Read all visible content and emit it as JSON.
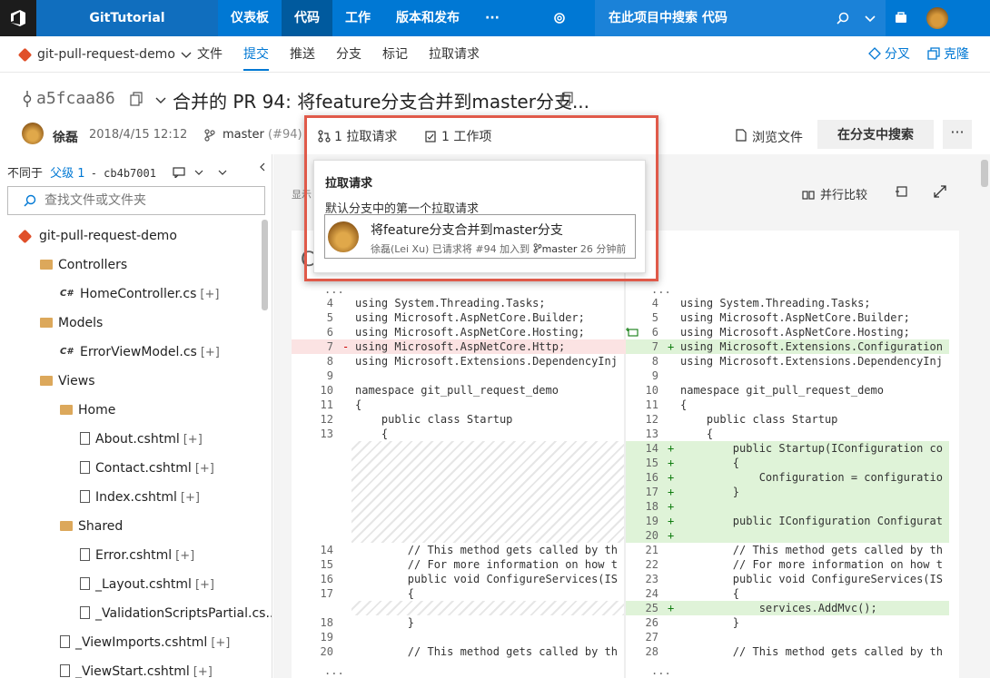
{
  "topbar": {
    "project": "GitTutorial",
    "nav": [
      "仪表板",
      "代码",
      "工作",
      "版本和发布",
      "···"
    ],
    "active": "代码",
    "search_placeholder": "在此项目中搜索 代码"
  },
  "subnav": {
    "repo": "git-pull-request-demo",
    "tabs": [
      "文件",
      "提交",
      "推送",
      "分支",
      "标记",
      "拉取请求"
    ],
    "active": "提交",
    "fork": "分叉",
    "clone": "克隆"
  },
  "commit": {
    "hash": "a5fcaa86",
    "title": "合并的 PR 94: 将feature分支合并到master分支...",
    "author": "徐磊",
    "date": "2018/4/15 12:12",
    "branch": "master",
    "branch_ref": "(#94)",
    "pull_requests": "1 拉取请求",
    "work_items": "1 工作项",
    "browse": "浏览文件",
    "search_branch": "在分支中搜索",
    "more": "···"
  },
  "callout": {
    "heading": "拉取请求",
    "desc": "默认分支中的第一个拉取请求",
    "pr_title": "将feature分支合并到master分支",
    "pr_user": "徐磊(Lei Xu)",
    "pr_action": "已请求将 #94 加入到",
    "pr_branch": "master",
    "pr_time": "26 分钟前"
  },
  "sidebar": {
    "compare": "不同于",
    "parent": "父级 1",
    "parent_hash": "- cb4b7001",
    "filter_placeholder": "查找文件或文件夹",
    "tree": [
      {
        "name": "git-pull-request-demo",
        "kind": "repo",
        "indent": 0
      },
      {
        "name": "Controllers",
        "kind": "folder",
        "indent": 1
      },
      {
        "name": "HomeController.cs",
        "kind": "cs",
        "indent": 2,
        "badge": "[+]"
      },
      {
        "name": "Models",
        "kind": "folder",
        "indent": 1
      },
      {
        "name": "ErrorViewModel.cs",
        "kind": "cs",
        "indent": 2,
        "badge": "[+]"
      },
      {
        "name": "Views",
        "kind": "folder",
        "indent": 1
      },
      {
        "name": "Home",
        "kind": "folder",
        "indent": 2
      },
      {
        "name": "About.cshtml",
        "kind": "file",
        "indent": 3,
        "badge": "[+]"
      },
      {
        "name": "Contact.cshtml",
        "kind": "file",
        "indent": 3,
        "badge": "[+]"
      },
      {
        "name": "Index.cshtml",
        "kind": "file",
        "indent": 3,
        "badge": "[+]"
      },
      {
        "name": "Shared",
        "kind": "folder",
        "indent": 2
      },
      {
        "name": "Error.cshtml",
        "kind": "file",
        "indent": 3,
        "badge": "[+]"
      },
      {
        "name": "_Layout.cshtml",
        "kind": "file",
        "indent": 3,
        "badge": "[+]"
      },
      {
        "name": "_ValidationScriptsPartial.cs...",
        "kind": "file",
        "indent": 3,
        "badge": ""
      },
      {
        "name": "_ViewImports.cshtml",
        "kind": "file",
        "indent": 2,
        "badge": "[+]"
      },
      {
        "name": "_ViewStart.cshtml",
        "kind": "file",
        "indent": 2,
        "badge": "[+]"
      }
    ]
  },
  "diff": {
    "show_label": "显示",
    "side_by_side": "并行比较",
    "ellipsis": "...",
    "left": [
      {
        "n": "4",
        "t": "using System.Threading.Tasks;",
        "k": ""
      },
      {
        "n": "5",
        "t": "using Microsoft.AspNetCore.Builder;",
        "k": ""
      },
      {
        "n": "6",
        "t": "using Microsoft.AspNetCore.Hosting;",
        "k": ""
      },
      {
        "n": "7",
        "t": "using Microsoft.AspNetCore.Http;",
        "k": "del"
      },
      {
        "n": "8",
        "t": "using Microsoft.Extensions.DependencyInj",
        "k": ""
      },
      {
        "n": "9",
        "t": "",
        "k": ""
      },
      {
        "n": "10",
        "t": "namespace git_pull_request_demo",
        "k": ""
      },
      {
        "n": "11",
        "t": "{",
        "k": ""
      },
      {
        "n": "12",
        "t": "    public class Startup",
        "k": ""
      },
      {
        "n": "13",
        "t": "    {",
        "k": ""
      },
      {
        "n": "14",
        "t": "        // This method gets called by th",
        "k": ""
      },
      {
        "n": "15",
        "t": "        // For more information on how t",
        "k": ""
      },
      {
        "n": "16",
        "t": "        public void ConfigureServices(IS",
        "k": ""
      },
      {
        "n": "17",
        "t": "        {",
        "k": ""
      },
      {
        "n": "18",
        "t": "        }",
        "k": ""
      },
      {
        "n": "19",
        "t": "",
        "k": ""
      },
      {
        "n": "20",
        "t": "        // This method gets called by th",
        "k": ""
      }
    ],
    "right": [
      {
        "n": "4",
        "t": "using System.Threading.Tasks;",
        "k": ""
      },
      {
        "n": "5",
        "t": "using Microsoft.AspNetCore.Builder;",
        "k": ""
      },
      {
        "n": "6",
        "t": "using Microsoft.AspNetCore.Hosting;",
        "k": ""
      },
      {
        "n": "7",
        "t": "using Microsoft.Extensions.Configuration",
        "k": "add"
      },
      {
        "n": "8",
        "t": "using Microsoft.Extensions.DependencyInj",
        "k": ""
      },
      {
        "n": "9",
        "t": "",
        "k": ""
      },
      {
        "n": "10",
        "t": "namespace git_pull_request_demo",
        "k": ""
      },
      {
        "n": "11",
        "t": "{",
        "k": ""
      },
      {
        "n": "12",
        "t": "    public class Startup",
        "k": ""
      },
      {
        "n": "13",
        "t": "    {",
        "k": ""
      },
      {
        "n": "14",
        "t": "        public Startup(IConfiguration co",
        "k": "add"
      },
      {
        "n": "15",
        "t": "        {",
        "k": "add"
      },
      {
        "n": "16",
        "t": "            Configuration = configuratio",
        "k": "add"
      },
      {
        "n": "17",
        "t": "        }",
        "k": "add"
      },
      {
        "n": "18",
        "t": "",
        "k": "add"
      },
      {
        "n": "19",
        "t": "        public IConfiguration Configurat",
        "k": "add"
      },
      {
        "n": "20",
        "t": "",
        "k": "add"
      },
      {
        "n": "21",
        "t": "        // This method gets called by th",
        "k": ""
      },
      {
        "n": "22",
        "t": "        // For more information on how t",
        "k": ""
      },
      {
        "n": "23",
        "t": "        public void ConfigureServices(IS",
        "k": ""
      },
      {
        "n": "24",
        "t": "        {",
        "k": ""
      },
      {
        "n": "25",
        "t": "            services.AddMvc();",
        "k": "add"
      },
      {
        "n": "26",
        "t": "        }",
        "k": ""
      },
      {
        "n": "27",
        "t": "",
        "k": ""
      },
      {
        "n": "28",
        "t": "        // This method gets called by th",
        "k": ""
      }
    ]
  }
}
